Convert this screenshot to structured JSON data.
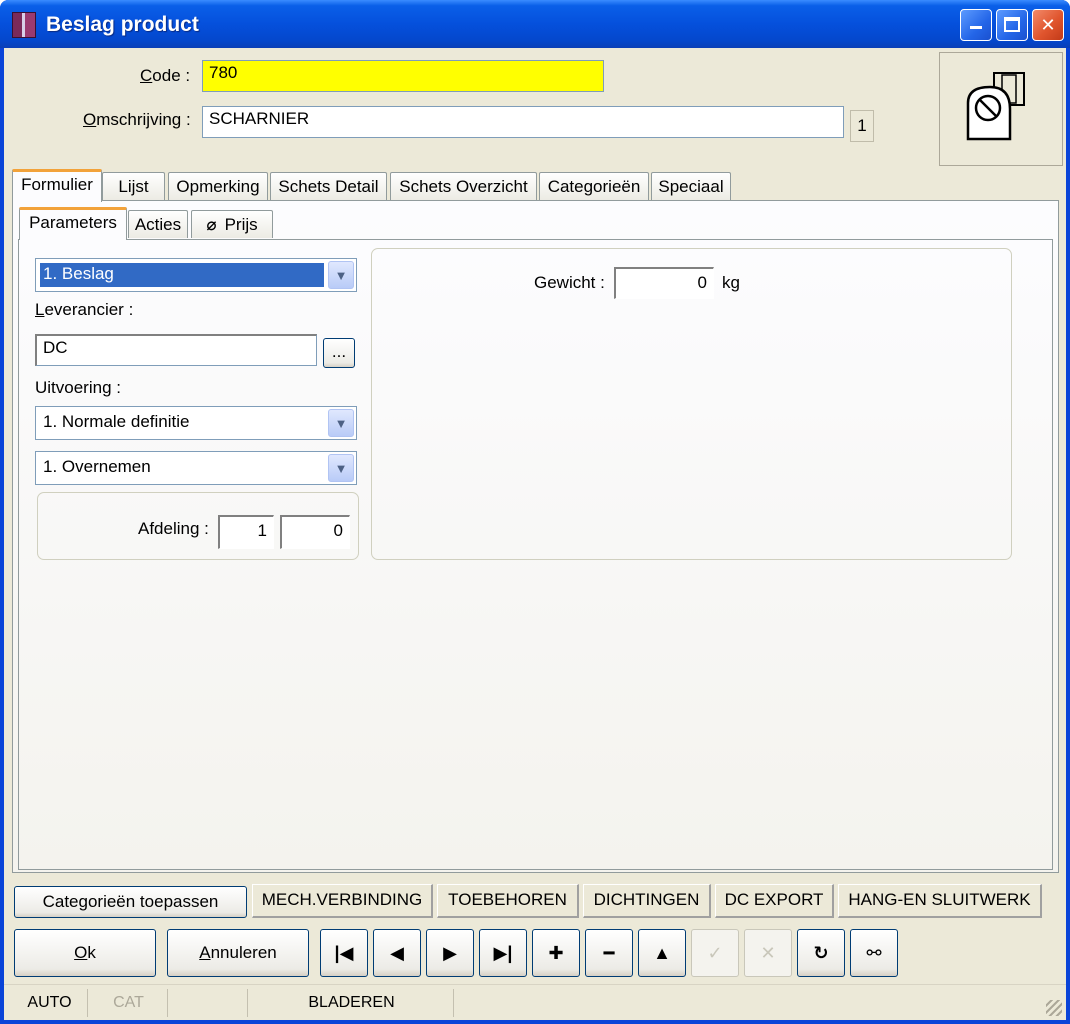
{
  "window": {
    "title": "Beslag product",
    "controls": {
      "minimize": "_",
      "maximize": "☐",
      "close": "✕"
    }
  },
  "header": {
    "code_label": "Code :",
    "code_value": "780",
    "omschrijving_label": "Omschrijving :",
    "omschrijving_value": "SCHARNIER",
    "omschrijving_count": "1",
    "preview_icon": "hinge-icon"
  },
  "tabs": [
    {
      "label": "Formulier",
      "active": true
    },
    {
      "label": "Lijst"
    },
    {
      "label": "Opmerking"
    },
    {
      "label": "Schets Detail"
    },
    {
      "label": "Schets Overzicht"
    },
    {
      "label": "Categorieën"
    },
    {
      "label": "Speciaal"
    }
  ],
  "subtabs": [
    {
      "label": "Parameters",
      "active": true
    },
    {
      "label": "Acties"
    },
    {
      "label": "Prijs",
      "icon": "paperclip-icon"
    }
  ],
  "form": {
    "type_select": "1.  Beslag",
    "leverancier_label": "Leverancier :",
    "leverancier_value": "DC",
    "browse_label": "...",
    "uitvoering_label": "Uitvoering :",
    "uitvoering_select": "1.  Normale definitie",
    "overnemen_select": "1.  Overnemen",
    "afdeling_label": "Afdeling :",
    "afdeling_value_1": "1",
    "afdeling_value_2": "0",
    "gewicht_label": "Gewicht :",
    "gewicht_value": "0",
    "gewicht_unit": "kg"
  },
  "category_buttons": {
    "apply": "Categorieën toepassen",
    "items": [
      "MECH.VERBINDING",
      "TOEBEHOREN",
      "DICHTINGEN",
      "DC EXPORT",
      "HANG-EN SLUITWERK"
    ]
  },
  "actions": {
    "ok": "Ok",
    "cancel": "Annuleren",
    "nav_icons": [
      "first-record-icon",
      "previous-record-icon",
      "next-record-icon",
      "last-record-icon",
      "add-record-icon",
      "delete-record-icon",
      "up-icon",
      "confirm-icon",
      "discard-icon",
      "refresh-icon",
      "search-binoculars-icon"
    ]
  },
  "statusbar": {
    "mode": "AUTO",
    "cat": "CAT",
    "state": "BLADEREN"
  }
}
